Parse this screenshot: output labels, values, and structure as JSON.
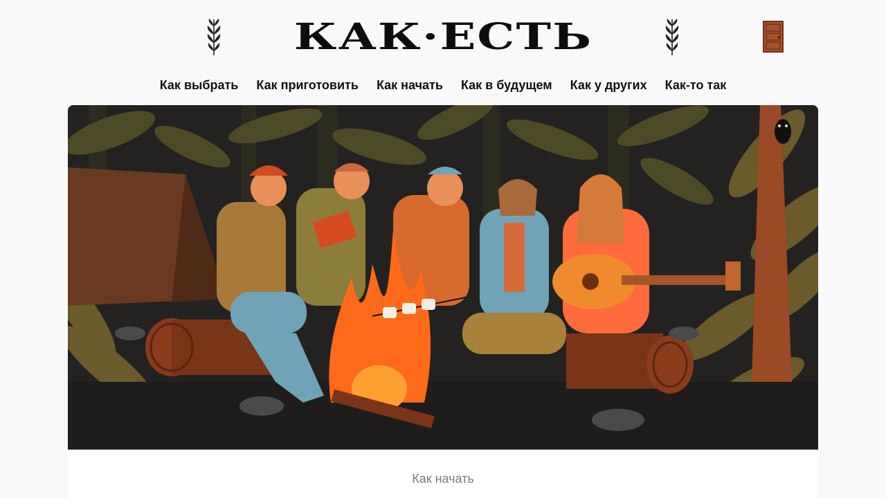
{
  "site": {
    "logo_text": "КАК·ЕСТЬ",
    "icons": {
      "left_ornament": "wheat-sprig-icon",
      "right_ornament": "wheat-sprig-icon",
      "account": "door-icon"
    },
    "colors": {
      "background": "#f9f9f9",
      "text": "#111111",
      "door": "#a8512f",
      "rubric": "#7a7a7a"
    }
  },
  "nav": {
    "items": [
      {
        "label": "Как выбрать"
      },
      {
        "label": "Как приготовить"
      },
      {
        "label": "Как начать"
      },
      {
        "label": "Как в будущем"
      },
      {
        "label": "Как у других"
      },
      {
        "label": "Как-то так"
      }
    ]
  },
  "hero": {
    "scene": "campfire-illustration",
    "colors": {
      "night": "#232221",
      "tree": "#6b5a2a",
      "fire": "#ff6a1a",
      "flame_core": "#ffa030"
    }
  },
  "article": {
    "rubric": "Как начать"
  }
}
